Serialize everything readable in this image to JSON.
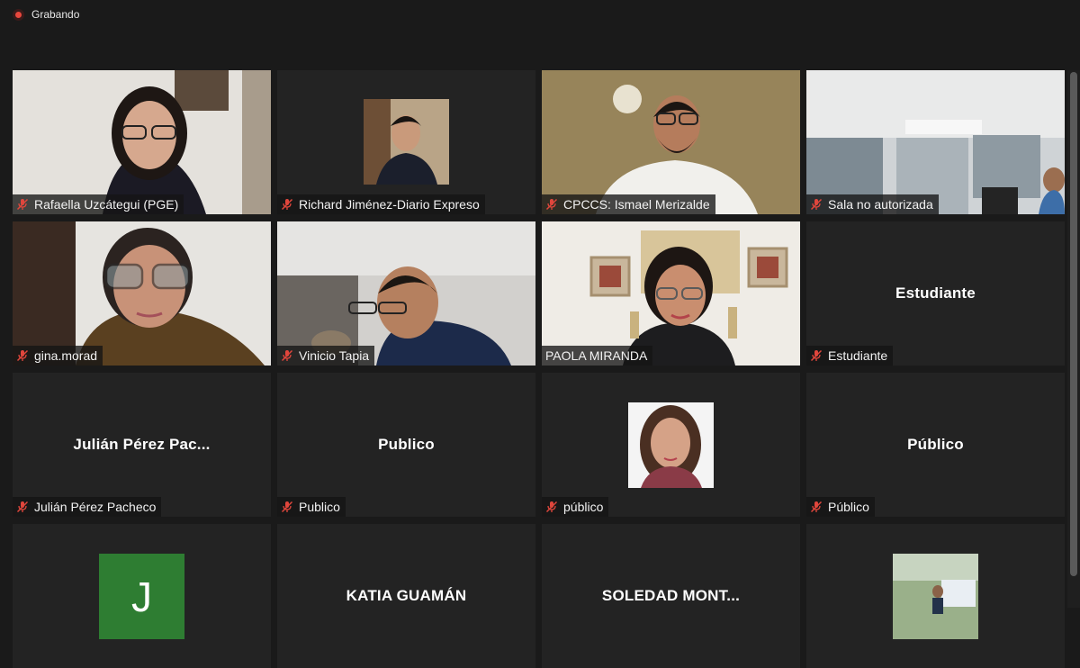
{
  "recording": {
    "label": "Grabando",
    "color": "#e8473d"
  },
  "participants": [
    {
      "display_name": "Rafaella Uzcátegui (PGE)",
      "video": "camera",
      "muted": true
    },
    {
      "display_name": "Richard Jiménez-Diario Expreso",
      "video": "camera-small",
      "muted": true
    },
    {
      "display_name": "CPCCS: Ismael Merizalde",
      "video": "camera",
      "muted": true
    },
    {
      "display_name": "Sala no autorizada",
      "video": "camera",
      "muted": true
    },
    {
      "display_name": "gina.morad",
      "video": "camera",
      "muted": true
    },
    {
      "display_name": "Vinicio Tapia",
      "video": "camera",
      "muted": true
    },
    {
      "display_name": "PAOLA MIRANDA",
      "video": "camera",
      "muted": false,
      "active_speaker": true
    },
    {
      "display_name": "Estudiante",
      "center_label": "Estudiante",
      "video": "off",
      "muted": true
    },
    {
      "display_name": "Julián Pérez Pacheco",
      "center_label": "Julián Pérez Pac...",
      "video": "off",
      "muted": true
    },
    {
      "display_name": "Publico",
      "center_label": "Publico",
      "video": "off",
      "muted": true
    },
    {
      "display_name": "público",
      "video": "avatar-photo",
      "muted": true
    },
    {
      "display_name": "Público",
      "center_label": "Público",
      "video": "off",
      "muted": true
    },
    {
      "avatar_initial": "J",
      "video": "avatar-initial"
    },
    {
      "center_label": "KATIA GUAMÁN",
      "video": "off"
    },
    {
      "center_label": "SOLEDAD  MONT...",
      "video": "off"
    },
    {
      "video": "avatar-photo"
    }
  ],
  "colors": {
    "background": "#1a1a1a",
    "tile": "#232323",
    "active_speaker_border": "#c6e35a",
    "mute_icon": "#e0463c",
    "avatar_green": "#2e7d32"
  }
}
